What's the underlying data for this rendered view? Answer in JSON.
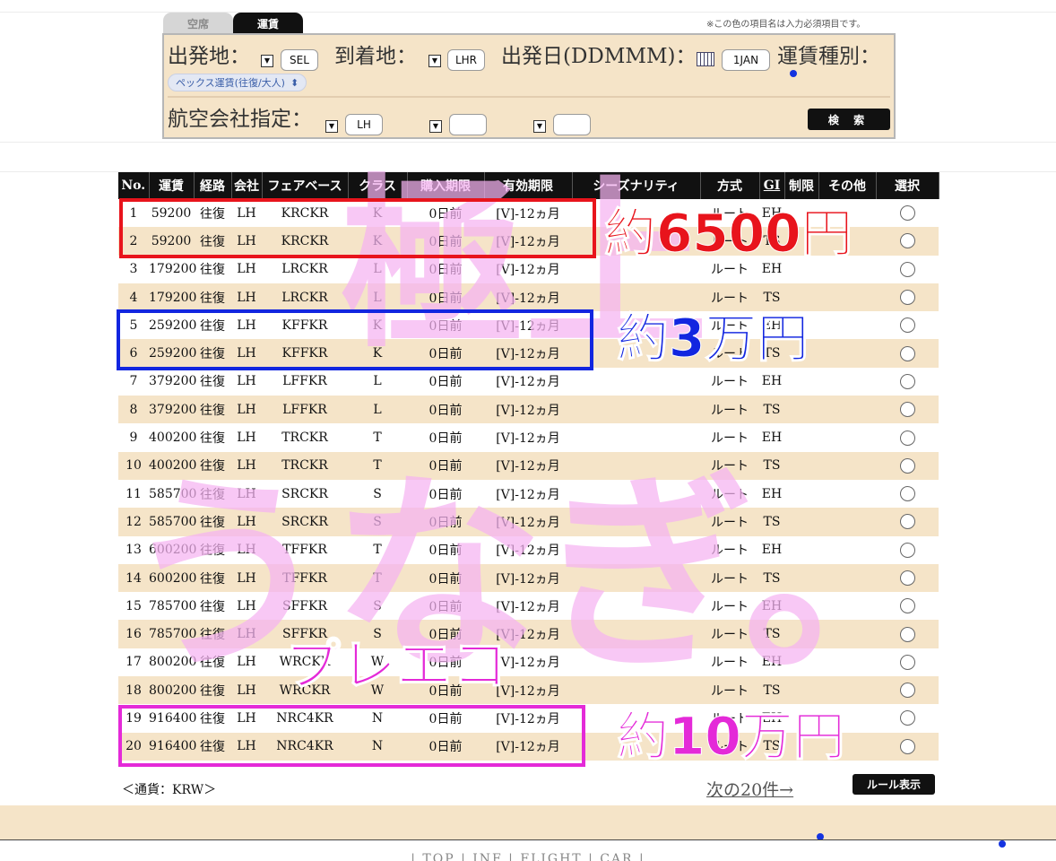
{
  "tabs": {
    "vacancy": "空席",
    "fare": "運賃"
  },
  "required_note": "※この色の項目名は入力必須項目です。",
  "search": {
    "origin_label": "出発地：",
    "origin_value": "SEL",
    "destination_label": "到着地：",
    "destination_value": "LHR",
    "date_label": "出発日(DDMMM)：",
    "date_value": "1JAN",
    "fare_type_label": "運賃種別：",
    "fare_type_value": "ペックス運賃(往復/大人)",
    "airline_label": "航空会社指定：",
    "airline_values": [
      "LH",
      "",
      ""
    ],
    "search_button": "検 索"
  },
  "table": {
    "headers": [
      "No.",
      "運賃",
      "経路",
      "会社",
      "フェアベース",
      "クラス",
      "購入期限",
      "有効期限",
      "シーズナリティ",
      "方式",
      "GI",
      "制限",
      "その他",
      "選択"
    ],
    "rows": [
      {
        "no": "1",
        "fare": "59200",
        "route": "往復",
        "carrier": "LH",
        "fare_basis": "KRCKR",
        "class": "K",
        "purchase": "0日前",
        "validity": "[V]-12ヵ月",
        "season": "",
        "method": "ルート",
        "gi": "EH"
      },
      {
        "no": "2",
        "fare": "59200",
        "route": "往復",
        "carrier": "LH",
        "fare_basis": "KRCKR",
        "class": "K",
        "purchase": "0日前",
        "validity": "[V]-12ヵ月",
        "season": "",
        "method": "ルート",
        "gi": "TS"
      },
      {
        "no": "3",
        "fare": "179200",
        "route": "往復",
        "carrier": "LH",
        "fare_basis": "LRCKR",
        "class": "L",
        "purchase": "0日前",
        "validity": "[V]-12ヵ月",
        "season": "",
        "method": "ルート",
        "gi": "EH"
      },
      {
        "no": "4",
        "fare": "179200",
        "route": "往復",
        "carrier": "LH",
        "fare_basis": "LRCKR",
        "class": "L",
        "purchase": "0日前",
        "validity": "[V]-12ヵ月",
        "season": "",
        "method": "ルート",
        "gi": "TS"
      },
      {
        "no": "5",
        "fare": "259200",
        "route": "往復",
        "carrier": "LH",
        "fare_basis": "KFFKR",
        "class": "K",
        "purchase": "0日前",
        "validity": "[V]-12ヵ月",
        "season": "",
        "method": "ルート",
        "gi": "EH"
      },
      {
        "no": "6",
        "fare": "259200",
        "route": "往復",
        "carrier": "LH",
        "fare_basis": "KFFKR",
        "class": "K",
        "purchase": "0日前",
        "validity": "[V]-12ヵ月",
        "season": "",
        "method": "ルート",
        "gi": "TS"
      },
      {
        "no": "7",
        "fare": "379200",
        "route": "往復",
        "carrier": "LH",
        "fare_basis": "LFFKR",
        "class": "L",
        "purchase": "0日前",
        "validity": "[V]-12ヵ月",
        "season": "",
        "method": "ルート",
        "gi": "EH"
      },
      {
        "no": "8",
        "fare": "379200",
        "route": "往復",
        "carrier": "LH",
        "fare_basis": "LFFKR",
        "class": "L",
        "purchase": "0日前",
        "validity": "[V]-12ヵ月",
        "season": "",
        "method": "ルート",
        "gi": "TS"
      },
      {
        "no": "9",
        "fare": "400200",
        "route": "往復",
        "carrier": "LH",
        "fare_basis": "TRCKR",
        "class": "T",
        "purchase": "0日前",
        "validity": "[V]-12ヵ月",
        "season": "",
        "method": "ルート",
        "gi": "EH"
      },
      {
        "no": "10",
        "fare": "400200",
        "route": "往復",
        "carrier": "LH",
        "fare_basis": "TRCKR",
        "class": "T",
        "purchase": "0日前",
        "validity": "[V]-12ヵ月",
        "season": "",
        "method": "ルート",
        "gi": "TS"
      },
      {
        "no": "11",
        "fare": "585700",
        "route": "往復",
        "carrier": "LH",
        "fare_basis": "SRCKR",
        "class": "S",
        "purchase": "0日前",
        "validity": "[V]-12ヵ月",
        "season": "",
        "method": "ルート",
        "gi": "EH"
      },
      {
        "no": "12",
        "fare": "585700",
        "route": "往復",
        "carrier": "LH",
        "fare_basis": "SRCKR",
        "class": "S",
        "purchase": "0日前",
        "validity": "[V]-12ヵ月",
        "season": "",
        "method": "ルート",
        "gi": "TS"
      },
      {
        "no": "13",
        "fare": "600200",
        "route": "往復",
        "carrier": "LH",
        "fare_basis": "TFFKR",
        "class": "T",
        "purchase": "0日前",
        "validity": "[V]-12ヵ月",
        "season": "",
        "method": "ルート",
        "gi": "EH"
      },
      {
        "no": "14",
        "fare": "600200",
        "route": "往復",
        "carrier": "LH",
        "fare_basis": "TFFKR",
        "class": "T",
        "purchase": "0日前",
        "validity": "[V]-12ヵ月",
        "season": "",
        "method": "ルート",
        "gi": "TS"
      },
      {
        "no": "15",
        "fare": "785700",
        "route": "往復",
        "carrier": "LH",
        "fare_basis": "SFFKR",
        "class": "S",
        "purchase": "0日前",
        "validity": "[V]-12ヵ月",
        "season": "",
        "method": "ルート",
        "gi": "EH"
      },
      {
        "no": "16",
        "fare": "785700",
        "route": "往復",
        "carrier": "LH",
        "fare_basis": "SFFKR",
        "class": "S",
        "purchase": "0日前",
        "validity": "[V]-12ヵ月",
        "season": "",
        "method": "ルート",
        "gi": "TS"
      },
      {
        "no": "17",
        "fare": "800200",
        "route": "往復",
        "carrier": "LH",
        "fare_basis": "WRCKR",
        "class": "W",
        "purchase": "0日前",
        "validity": "[V]-12ヵ月",
        "season": "",
        "method": "ルート",
        "gi": "EH"
      },
      {
        "no": "18",
        "fare": "800200",
        "route": "往復",
        "carrier": "LH",
        "fare_basis": "WRCKR",
        "class": "W",
        "purchase": "0日前",
        "validity": "[V]-12ヵ月",
        "season": "",
        "method": "ルート",
        "gi": "TS"
      },
      {
        "no": "19",
        "fare": "916400",
        "route": "往復",
        "carrier": "LH",
        "fare_basis": "NRC4KR",
        "class": "N",
        "purchase": "0日前",
        "validity": "[V]-12ヵ月",
        "season": "",
        "method": "ルート",
        "gi": "EH"
      },
      {
        "no": "20",
        "fare": "916400",
        "route": "往復",
        "carrier": "LH",
        "fare_basis": "NRC4KR",
        "class": "N",
        "purchase": "0日前",
        "validity": "[V]-12ヵ月",
        "season": "",
        "method": "ルート",
        "gi": "TS"
      }
    ]
  },
  "currency_note": "＜通貨：KRW＞",
  "next_link": "次の20件→",
  "rule_button": "ルール表示",
  "footer_text": "| TOP | INF | FLIGHT | CAR |",
  "overlay": {
    "giant_top": "極上",
    "giant_bottom": "うなぎ。",
    "callout_red": "約6500円",
    "callout_blue": "約3万円",
    "callout_premium": "プレエコ",
    "callout_magenta": "約10万円"
  },
  "colors": {
    "panel_bg": "#f5e4c8",
    "highlight_red": "#e8141c",
    "highlight_blue": "#1226e0",
    "highlight_magenta": "#e42ad8",
    "overlay_pink": "#f6b3f2"
  }
}
